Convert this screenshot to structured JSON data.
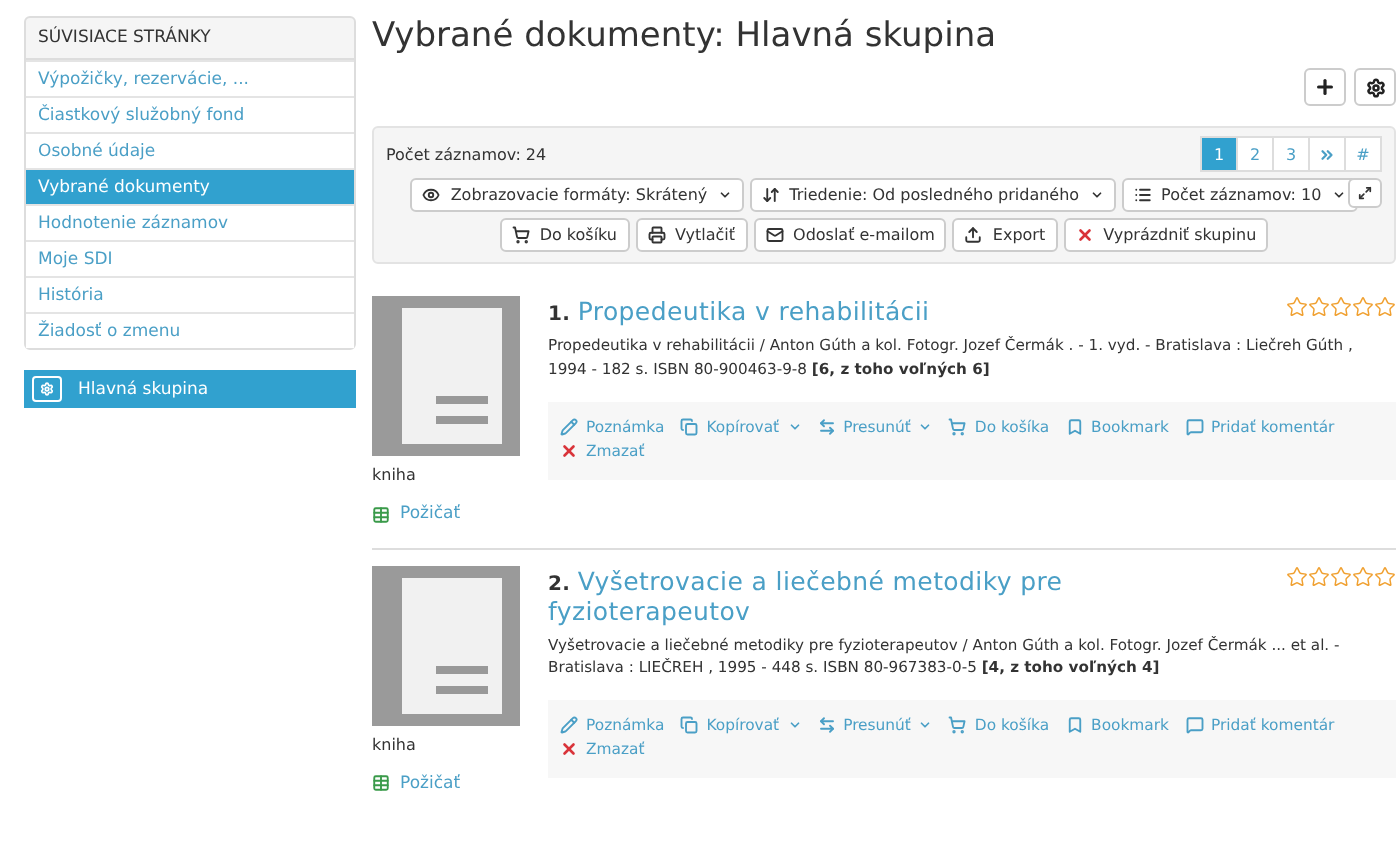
{
  "sidebar": {
    "heading": "SÚVISIACE STRÁNKY",
    "items": [
      {
        "label": "Výpožičky, rezervácie, ...",
        "selected": false
      },
      {
        "label": "Čiastkový služobný fond",
        "selected": false
      },
      {
        "label": "Osobné údaje",
        "selected": false
      },
      {
        "label": "Vybrané dokumenty",
        "selected": true
      },
      {
        "label": "Hodnotenie záznamov",
        "selected": false
      },
      {
        "label": "Moje SDI",
        "selected": false
      },
      {
        "label": "História",
        "selected": false
      },
      {
        "label": "Žiadosť o zmenu",
        "selected": false
      }
    ],
    "group": {
      "label": "Hlavná skupina"
    }
  },
  "title": "Vybrané dokumenty: Hlavná skupina",
  "toolbar": {
    "count": "Počet záznamov: 24",
    "pages": [
      {
        "label": "1",
        "selected": true
      },
      {
        "label": "2",
        "selected": false
      },
      {
        "label": "3",
        "selected": false
      },
      {
        "label": "#",
        "selected": false
      }
    ],
    "row1": [
      {
        "kind": "eye",
        "label": "Zobrazovacie formáty: Skrátený",
        "dropdown": true
      },
      {
        "kind": "sort",
        "label": "Triedenie: Od posledného pridaného",
        "dropdown": true
      },
      {
        "kind": "list",
        "label": "Počet záznamov: 10",
        "dropdown": true
      }
    ],
    "row2": [
      {
        "kind": "cart",
        "label": "Do košíku",
        "dropdown": false
      },
      {
        "kind": "print",
        "label": "Vytlačiť",
        "dropdown": false
      },
      {
        "kind": "mail",
        "label": "Odoslať e-mailom",
        "dropdown": false
      },
      {
        "kind": "export",
        "label": "Export",
        "dropdown": false
      },
      {
        "kind": "remove",
        "label": "Vyprázdniť skupinu",
        "dropdown": false
      }
    ]
  },
  "records": [
    {
      "number": "1.",
      "title": "Propedeutika v rehabilitácii",
      "stars": 0,
      "type": "kniha",
      "borrow": "Požičať",
      "description": "Propedeutika v rehabilitácii  / Anton Gúth a kol.  Fotogr. Jozef Čermák . - 1. vyd.  - Bratislava  : Liečreh Gúth , 1994  - 182 s.  ISBN 80-900463-9-8   **[6, z toho voľných 6]**",
      "actions": [
        {
          "kind": "pencil",
          "label": "Poznámka",
          "dropdown": false
        },
        {
          "kind": "copy",
          "label": "Kopírovať",
          "dropdown": true
        },
        {
          "kind": "move",
          "label": "Presunúť",
          "dropdown": true
        },
        {
          "kind": "cart",
          "label": "Do košíka",
          "dropdown": false
        },
        {
          "kind": "bookmark",
          "label": "Bookmark",
          "dropdown": false
        },
        {
          "kind": "comment",
          "label": "Pridať komentár",
          "dropdown": false
        },
        {
          "kind": "remove",
          "label": "Zmazať",
          "dropdown": false
        }
      ]
    },
    {
      "number": "2.",
      "title": "Vyšetrovacie a liečebné metodiky pre fyzioterapeutov",
      "stars": 0,
      "type": "kniha",
      "borrow": "Požičať",
      "description": "Vyšetrovacie a liečebné metodiky pre fyzioterapeutov  / Anton Gúth a kol.  Fotogr. Jozef Čermák ... et al.  - Bratislava  : LIEČREH , 1995  - 448 s.  ISBN 80-967383-0-5   **[4, z toho voľných 4]**",
      "actions": [
        {
          "kind": "pencil",
          "label": "Poznámka",
          "dropdown": false
        },
        {
          "kind": "copy",
          "label": "Kopírovať",
          "dropdown": true
        },
        {
          "kind": "move",
          "label": "Presunúť",
          "dropdown": true
        },
        {
          "kind": "cart",
          "label": "Do košíka",
          "dropdown": false
        },
        {
          "kind": "bookmark",
          "label": "Bookmark",
          "dropdown": false
        },
        {
          "kind": "comment",
          "label": "Pridať komentár",
          "dropdown": false
        },
        {
          "kind": "remove",
          "label": "Zmazať",
          "dropdown": false
        }
      ]
    }
  ]
}
